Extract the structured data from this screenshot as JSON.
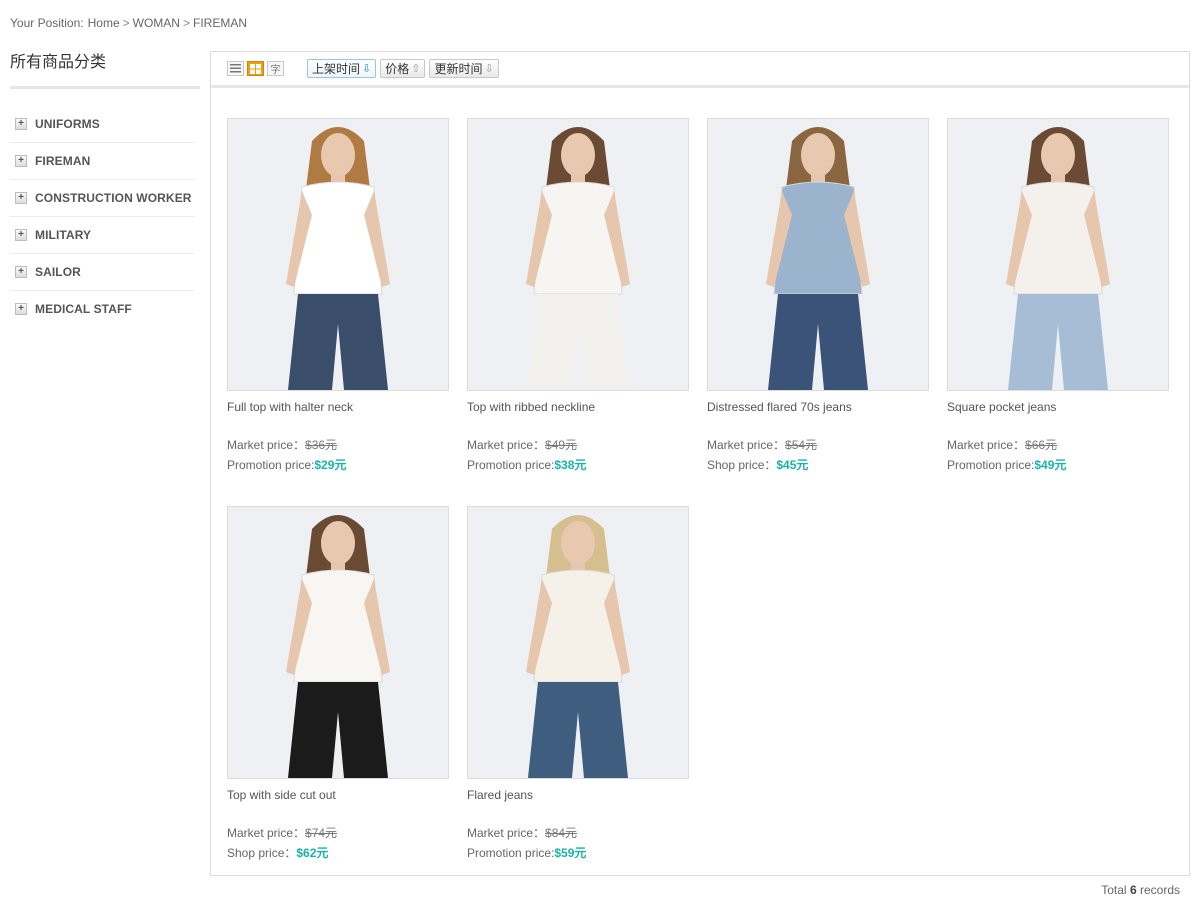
{
  "breadcrumb": {
    "label": "Your Position:",
    "items": [
      "Home",
      "WOMAN",
      "FIREMAN"
    ],
    "sep": ">"
  },
  "sidebar": {
    "title": "所有商品分类",
    "categories": [
      "UNIFORMS",
      "FIREMAN",
      "CONSTRUCTION WORKER",
      "MILITARY",
      "SAILOR",
      "MEDICAL STAFF"
    ]
  },
  "toolbar": {
    "sort_shelf_time": "上架时间",
    "sort_price": "价格",
    "sort_update_time": "更新时间",
    "arrow_down": "⇩",
    "arrow_up": "⇧"
  },
  "products": [
    {
      "name": "Full top with halter neck",
      "market_label": "Market price：",
      "market_price": "$36元",
      "sale_label": "Promotion price:",
      "sale_price": "$29元",
      "top": "#ffffff",
      "bottom": "#3a4d6b",
      "hair": "#b07a43"
    },
    {
      "name": "Top with ribbed neckline",
      "market_label": "Market price：",
      "market_price": "$49元",
      "sale_label": "Promotion price:",
      "sale_price": "$38元",
      "top": "#f6f5f1",
      "bottom": "#f1f0ec",
      "hair": "#6b4a34"
    },
    {
      "name": "Distressed flared 70s jeans",
      "market_label": "Market price：",
      "market_price": "$54元",
      "sale_label": "Shop price：",
      "sale_price": "$45元",
      "top": "#9bb3cd",
      "bottom": "#3b5378",
      "hair": "#8a6640"
    },
    {
      "name": "Square pocket jeans",
      "market_label": "Market price：",
      "market_price": "$66元",
      "sale_label": "Promotion price:",
      "sale_price": "$49元",
      "top": "#f4f1ec",
      "bottom": "#a7bdd6",
      "hair": "#6b4a34"
    },
    {
      "name": "Top with side cut out",
      "market_label": "Market price：",
      "market_price": "$74元",
      "sale_label": "Shop price：",
      "sale_price": "$62元",
      "top": "#f7f6f2",
      "bottom": "#1b1b1b",
      "hair": "#6b4a34"
    },
    {
      "name": "Flared jeans",
      "market_label": "Market price：",
      "market_price": "$84元",
      "sale_label": "Promotion price:",
      "sale_price": "$59元",
      "top": "#f5f1e8",
      "bottom": "#3e5d7f",
      "hair": "#d6bf8f"
    }
  ],
  "footer": {
    "prefix": "Total",
    "count": "6",
    "suffix": "records"
  }
}
